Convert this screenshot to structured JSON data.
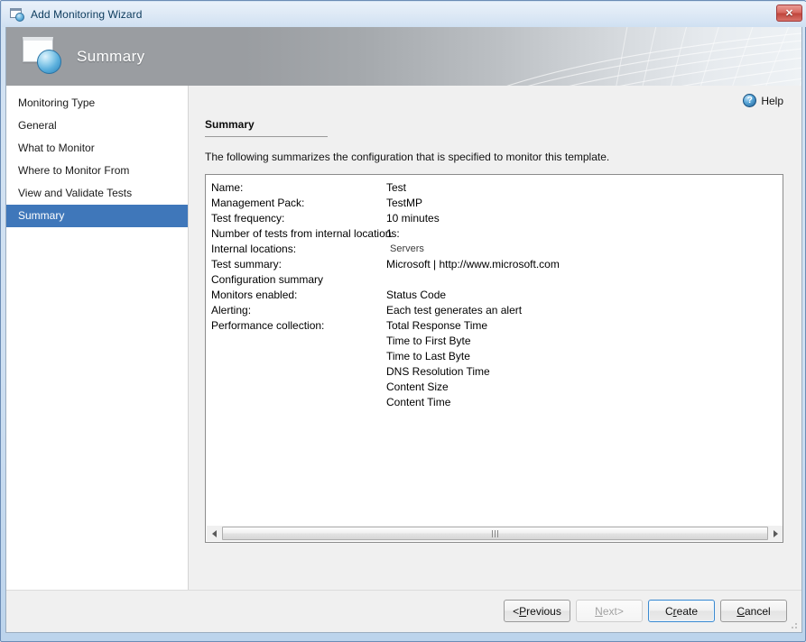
{
  "window": {
    "title": "Add Monitoring Wizard",
    "close_label": "✕",
    "icon": "window-globe-icon"
  },
  "banner": {
    "title": "Summary",
    "icon": "window-globe-icon"
  },
  "sidebar": {
    "items": [
      {
        "label": "Monitoring Type",
        "active": false
      },
      {
        "label": "General",
        "active": false
      },
      {
        "label": "What to Monitor",
        "active": false
      },
      {
        "label": "Where to Monitor From",
        "active": false
      },
      {
        "label": "View and Validate Tests",
        "active": false
      },
      {
        "label": "Summary",
        "active": true
      }
    ]
  },
  "content": {
    "help_label": "Help",
    "help_icon_glyph": "?",
    "title": "Summary",
    "description": "The following summarizes the configuration that is specified to monitor this template.",
    "rows": [
      {
        "label": "Name:",
        "value": "Test",
        "small": false
      },
      {
        "label": "Management Pack:",
        "value": "TestMP",
        "small": false
      },
      {
        "label": "Test frequency:",
        "value": "10 minutes",
        "small": false
      },
      {
        "label": "Number of tests from internal locations:",
        "value": "1",
        "small": false
      },
      {
        "label": "Internal locations:",
        "value": "Servers",
        "small": true
      },
      {
        "label": "Test summary:",
        "value": "Microsoft | http://www.microsoft.com",
        "small": false
      },
      {
        "label": "Configuration summary",
        "value": "",
        "small": false
      },
      {
        "label": "Monitors enabled:",
        "value": "Status Code",
        "small": false
      },
      {
        "label": "Alerting:",
        "value": "Each test generates an alert",
        "small": false
      },
      {
        "label": "Performance collection:",
        "value": "Total Response Time",
        "small": false
      },
      {
        "label": "",
        "value": "Time to First Byte",
        "small": false
      },
      {
        "label": "",
        "value": "Time to Last Byte",
        "small": false
      },
      {
        "label": "",
        "value": "DNS Resolution Time",
        "small": false
      },
      {
        "label": "",
        "value": "Content Size",
        "small": false
      },
      {
        "label": "",
        "value": "Content Time",
        "small": false
      }
    ]
  },
  "scrollbar": {
    "left_arrow": "◀",
    "right_arrow": "▶"
  },
  "footer": {
    "buttons": [
      {
        "id": "previous",
        "prefix": "< ",
        "accel": "P",
        "rest": "revious",
        "suffix": "",
        "state": "enabled"
      },
      {
        "id": "next",
        "prefix": "",
        "accel": "N",
        "rest": "ext",
        "suffix": " >",
        "state": "disabled"
      },
      {
        "id": "create",
        "prefix": "C",
        "accel": "r",
        "rest": "eate",
        "suffix": "",
        "state": "default"
      },
      {
        "id": "cancel",
        "prefix": "",
        "accel": "C",
        "rest": "ancel",
        "suffix": "",
        "state": "enabled"
      }
    ]
  },
  "colors": {
    "accent": "#3f77ba",
    "frame": "#cfe0f2",
    "content_bg": "#f0f0f0",
    "close_button": "#c0463c"
  }
}
